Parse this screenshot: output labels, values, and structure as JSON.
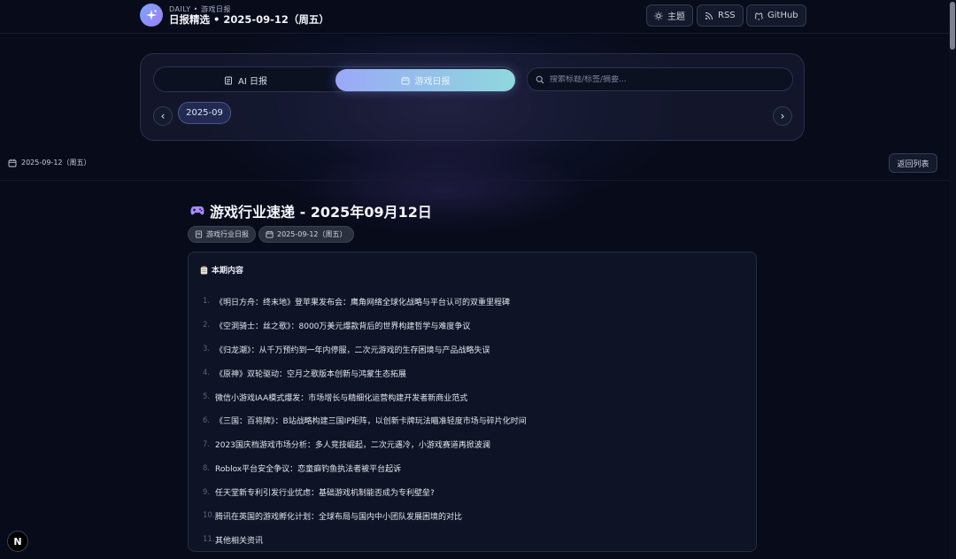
{
  "header": {
    "brand_sub": "DAILY • 游戏日报",
    "brand_title": "日报精选 • 2025-09-12（周五）",
    "logo_icon": "sparkle-icon",
    "buttons": [
      {
        "label": "主题",
        "icon": "sun-icon"
      },
      {
        "label": "RSS",
        "icon": "rss-icon"
      },
      {
        "label": "GitHub",
        "icon": "github-icon"
      }
    ]
  },
  "tabs": [
    {
      "label": "AI 日报",
      "icon": "document-icon",
      "active": false
    },
    {
      "label": "游戏日报",
      "icon": "calendar-icon",
      "active": true
    }
  ],
  "search": {
    "placeholder": "搜索标题/标签/摘要..."
  },
  "month_nav": {
    "current": "2025-09",
    "prev": "‹",
    "next": "›"
  },
  "subbar": {
    "date": "2025-09-12（周五）",
    "back_label": "返回列表"
  },
  "article": {
    "title": "游戏行业速递 - 2025年09月12日",
    "title_icon": "gamepad-icon",
    "tags": [
      {
        "label": "游戏行业日报",
        "icon": "document-icon"
      },
      {
        "label": "2025-09-12（周五）",
        "icon": "calendar-icon"
      }
    ],
    "toc_heading": "本期内容",
    "toc_items": [
      {
        "num": "1.",
        "text": "《明日方舟：终末地》登苹果发布会：鹰角网络全球化战略与平台认可的双重里程碑"
      },
      {
        "num": "2.",
        "text": "《空洞骑士：丝之歌》：8000万美元爆款背后的世界构建哲学与难度争议"
      },
      {
        "num": "3.",
        "text": "《归龙潮》：从千万预约到一年内停服，二次元游戏的生存困境与产品战略失误"
      },
      {
        "num": "4.",
        "text": "《原神》双轮驱动：空月之歌版本创新与鸿蒙生态拓展"
      },
      {
        "num": "5.",
        "text": "微信小游戏IAA模式爆发：市场增长与精细化运营构建开发者新商业范式"
      },
      {
        "num": "6.",
        "text": "《三国：百将牌》：B站战略构建三国IP矩阵，以创新卡牌玩法瞄准轻度市场与碎片化时间"
      },
      {
        "num": "7.",
        "text": "2023国庆档游戏市场分析：多人竞技崛起，二次元遇冷，小游戏赛道再掀波澜"
      },
      {
        "num": "8.",
        "text": "Roblox平台安全争议：恋童癖钓鱼执法者被平台起诉"
      },
      {
        "num": "9.",
        "text": "任天堂新专利引发行业忧虑：基础游戏机制能否成为专利壁垒?"
      },
      {
        "num": "10.",
        "text": "腾讯在英国的游戏孵化计划：全球布局与国内中小团队发展困境的对比"
      },
      {
        "num": "11.",
        "text": "其他相关资讯"
      }
    ]
  },
  "badge": {
    "letter": "N"
  }
}
